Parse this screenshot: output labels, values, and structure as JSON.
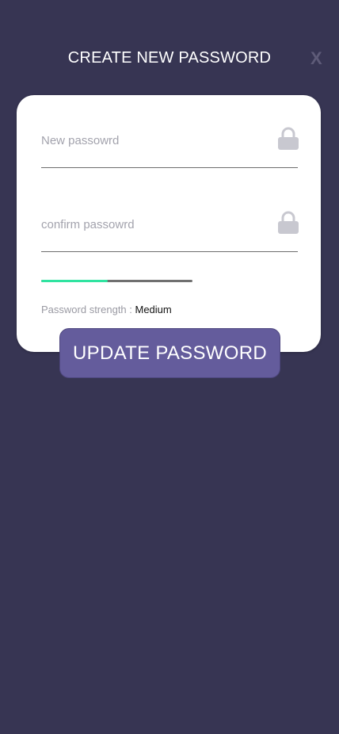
{
  "header": {
    "title": "CREATE NEW PASSWORD",
    "close_label": "X"
  },
  "form": {
    "new_password": {
      "value": "",
      "placeholder": "New passowrd",
      "icon": "lock-icon"
    },
    "confirm_password": {
      "value": "",
      "placeholder": "confirm passowrd",
      "icon": "lock-icon"
    },
    "strength": {
      "label": "Password strength : ",
      "value": "Medium",
      "fill_fraction": 0.44,
      "fill_color": "#2fe3a0",
      "track_color": "#707070"
    },
    "submit_label": "UPDATE PASSWORD"
  },
  "colors": {
    "background": "#373553",
    "card": "#ffffff",
    "button": "#645c9c",
    "icon": "#c8c8d0"
  }
}
